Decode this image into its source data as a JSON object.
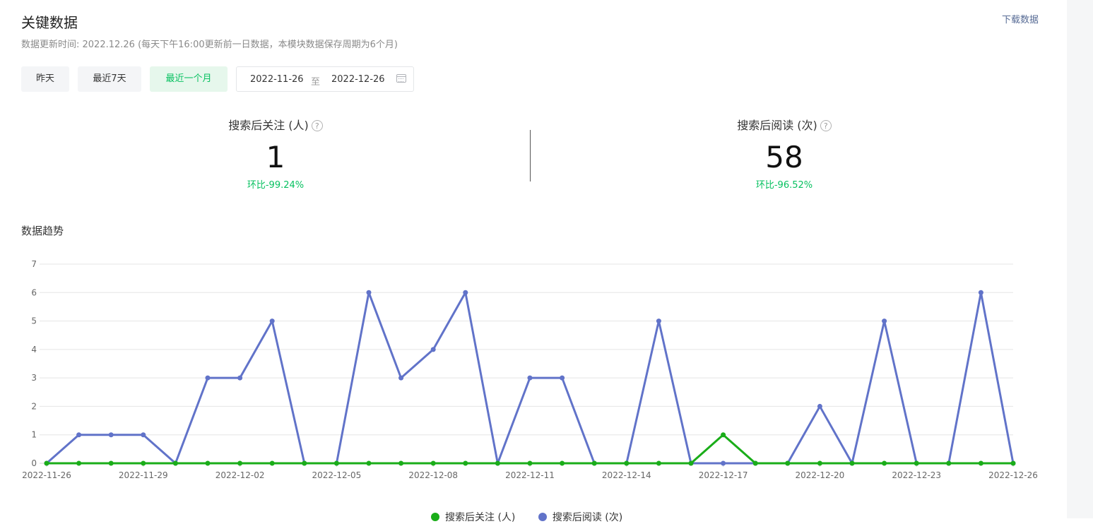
{
  "header": {
    "title": "关键数据",
    "download_label": "下载数据",
    "update_note": "数据更新时间: 2022.12.26 (每天下午16:00更新前一日数据，本模块数据保存周期为6个月)"
  },
  "range_buttons": [
    {
      "label": "昨天",
      "active": false
    },
    {
      "label": "最近7天",
      "active": false
    },
    {
      "label": "最近一个月",
      "active": true
    }
  ],
  "date_picker": {
    "start": "2022-11-26",
    "separator": "至",
    "end": "2022-12-26"
  },
  "metrics": [
    {
      "label": "搜索后关注 (人)",
      "value": "1",
      "change": "环比-99.24%"
    },
    {
      "label": "搜索后阅读 (次)",
      "value": "58",
      "change": "环比-96.52%"
    }
  ],
  "trend": {
    "title": "数据趋势"
  },
  "colors": {
    "accent_green": "#07c160",
    "series_green": "#1aad19",
    "series_blue": "#6173c9",
    "grid": "#e5e5e5"
  },
  "chart_data": {
    "type": "line",
    "x": [
      "2022-11-26",
      "2022-11-27",
      "2022-11-28",
      "2022-11-29",
      "2022-11-30",
      "2022-12-01",
      "2022-12-02",
      "2022-12-03",
      "2022-12-04",
      "2022-12-05",
      "2022-12-06",
      "2022-12-07",
      "2022-12-08",
      "2022-12-09",
      "2022-12-10",
      "2022-12-11",
      "2022-12-12",
      "2022-12-13",
      "2022-12-14",
      "2022-12-15",
      "2022-12-16",
      "2022-12-17",
      "2022-12-18",
      "2022-12-19",
      "2022-12-20",
      "2022-12-21",
      "2022-12-22",
      "2022-12-23",
      "2022-12-24",
      "2022-12-25",
      "2022-12-26"
    ],
    "x_tick_labels": [
      "2022-11-26",
      "2022-11-29",
      "2022-12-02",
      "2022-12-05",
      "2022-12-08",
      "2022-12-11",
      "2022-12-14",
      "2022-12-17",
      "2022-12-20",
      "2022-12-23",
      "2022-12-26"
    ],
    "yticks": [
      0,
      1,
      2,
      3,
      4,
      5,
      6,
      7
    ],
    "ylim": [
      0,
      7
    ],
    "grid": true,
    "legend_position": "bottom-center",
    "series": [
      {
        "name": "搜索后关注 (人)",
        "color": "#1aad19",
        "values": [
          0,
          0,
          0,
          0,
          0,
          0,
          0,
          0,
          0,
          0,
          0,
          0,
          0,
          0,
          0,
          0,
          0,
          0,
          0,
          0,
          0,
          1,
          0,
          0,
          0,
          0,
          0,
          0,
          0,
          0,
          0
        ]
      },
      {
        "name": "搜索后阅读 (次)",
        "color": "#6173c9",
        "values": [
          0,
          1,
          1,
          1,
          0,
          3,
          3,
          5,
          0,
          0,
          6,
          3,
          4,
          6,
          0,
          3,
          3,
          0,
          0,
          5,
          0,
          0,
          0,
          0,
          2,
          0,
          5,
          0,
          0,
          6,
          0
        ]
      }
    ]
  }
}
